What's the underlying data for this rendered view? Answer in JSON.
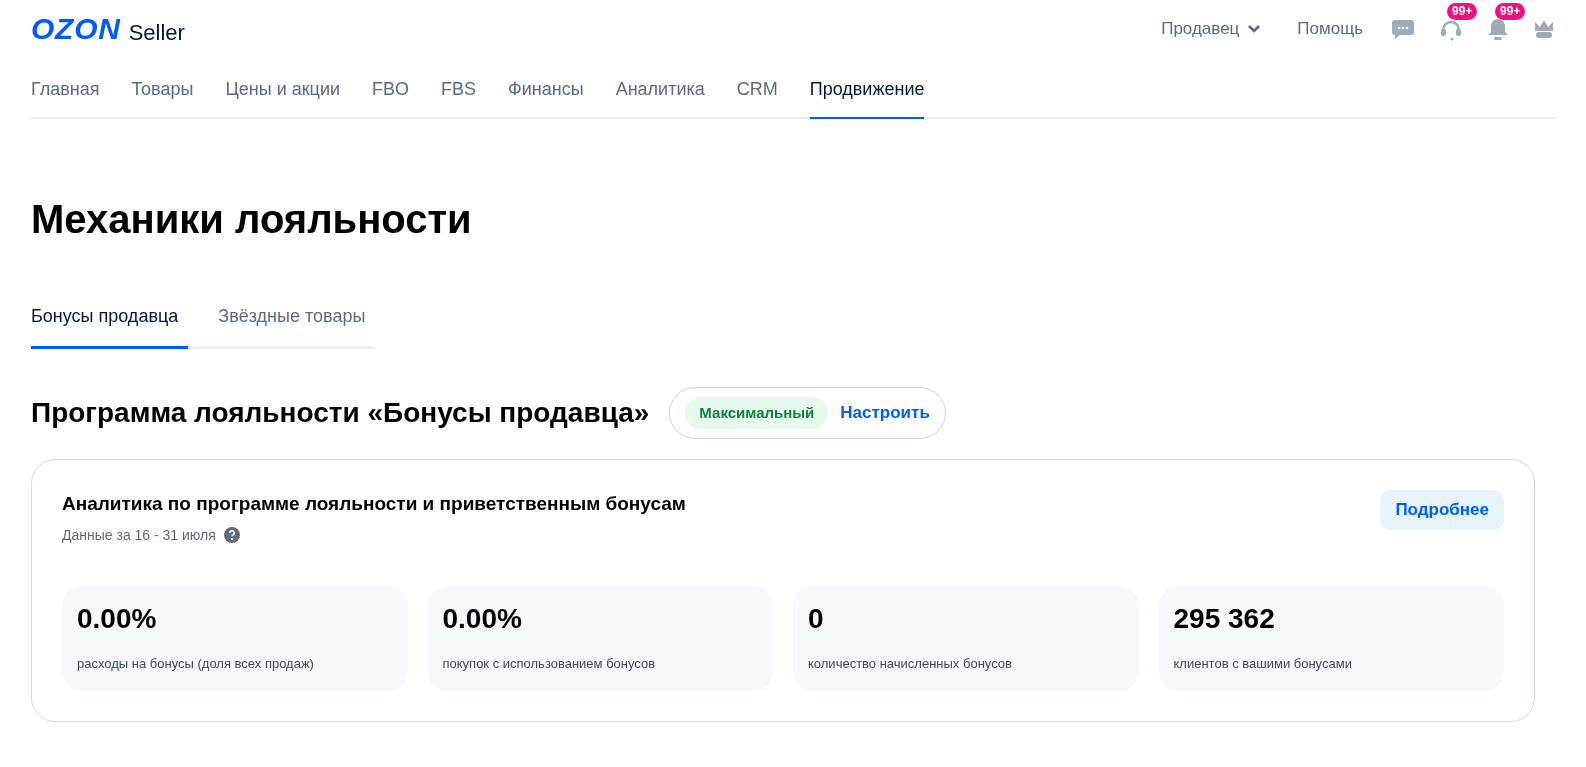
{
  "header": {
    "logo": "OZON",
    "logo_suffix": "Seller",
    "seller_menu": "Продавец",
    "help": "Помощь",
    "icons": [
      {
        "kind": "chat"
      },
      {
        "kind": "support",
        "badge": "99+"
      },
      {
        "kind": "bell",
        "badge": "99+"
      },
      {
        "kind": "crown"
      }
    ]
  },
  "nav": [
    {
      "label": "Главная",
      "selected": false
    },
    {
      "label": "Товары",
      "selected": false
    },
    {
      "label": "Цены и акции",
      "selected": false
    },
    {
      "label": "FBO",
      "selected": false
    },
    {
      "label": "FBS",
      "selected": false
    },
    {
      "label": "Финансы",
      "selected": false
    },
    {
      "label": "Аналитика",
      "selected": false
    },
    {
      "label": "CRM",
      "selected": false
    },
    {
      "label": "Продвижение",
      "selected": true
    }
  ],
  "page_title": "Механики лояльности",
  "tabs": [
    {
      "label": "Бонусы продавца",
      "selected": true
    },
    {
      "label": "Звёздные товары",
      "selected": false
    }
  ],
  "program": {
    "title": "Программа лояльности «Бонусы продавца»",
    "level_badge": "Максимальный",
    "configure": "Настроить"
  },
  "analytics": {
    "title": "Аналитика по программе лояльности и приветственным бонусам",
    "period": "Данные за 16 - 31 июля",
    "details_button": "Подробнее",
    "metrics": [
      {
        "value": "0.00%",
        "label": "расходы на бонусы (доля всех продаж)"
      },
      {
        "value": "0.00%",
        "label": "покупок с использованием бонусов"
      },
      {
        "value": "0",
        "label": "количество начисленных бонусов"
      },
      {
        "value": "295 362",
        "label": "клиентов с вашими бонусами"
      }
    ]
  }
}
